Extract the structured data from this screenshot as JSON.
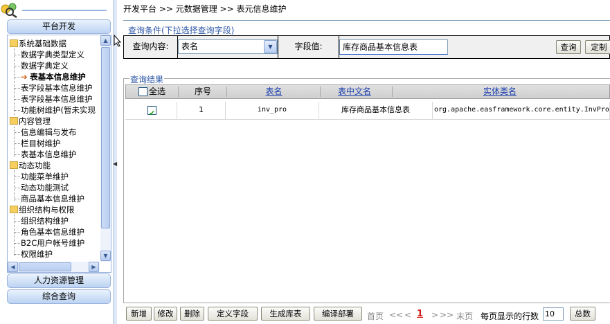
{
  "nav": {
    "headers": {
      "platform_dev": "平台开发",
      "hr_management": "人力资源管理",
      "combined_query": "综合查询"
    },
    "tree": [
      {
        "label": "系统基础数据",
        "type": "folder"
      },
      {
        "label": "数据字典类型定义",
        "type": "leaf"
      },
      {
        "label": "数据字典定义",
        "type": "leaf"
      },
      {
        "label": "表基本信息维护",
        "type": "leaf",
        "selected": true
      },
      {
        "label": "表字段基本信息维护",
        "type": "leaf"
      },
      {
        "label": "表字段基本信息维护",
        "type": "leaf"
      },
      {
        "label": "功能树维护(暂未实现",
        "type": "leaf"
      },
      {
        "label": "内容管理",
        "type": "folder"
      },
      {
        "label": "信息编辑与发布",
        "type": "leaf"
      },
      {
        "label": "栏目树维护",
        "type": "leaf"
      },
      {
        "label": "表基本信息维护",
        "type": "leaf"
      },
      {
        "label": "动态功能",
        "type": "folder"
      },
      {
        "label": "功能菜单维护",
        "type": "leaf"
      },
      {
        "label": "动态功能测试",
        "type": "leaf"
      },
      {
        "label": "商品基本信息维护",
        "type": "leaf"
      },
      {
        "label": "组织结构与权限",
        "type": "folder"
      },
      {
        "label": "组织结构维护",
        "type": "leaf"
      },
      {
        "label": "角色基本信息维护",
        "type": "leaf"
      },
      {
        "label": "B2C用户帐号维护",
        "type": "leaf"
      },
      {
        "label": "权限维护",
        "type": "leaf"
      }
    ]
  },
  "breadcrumb": "开发平台 >> 元数据管理 >> 表元信息维护",
  "query": {
    "section_title": "查询条件(下拉选择查询字段)",
    "content_label": "查询内容:",
    "content_value": "表名",
    "field_label": "字段值:",
    "field_value": "库存商品基本信息表",
    "query_button": "查询",
    "custom_button": "定制"
  },
  "results": {
    "section_title": "查询结果",
    "headers": {
      "select_all": "全选",
      "index": "序号",
      "table_name": "表名",
      "cn_name": "表中文名",
      "entity_class": "实体类名"
    },
    "rows": [
      {
        "checked": true,
        "index": "1",
        "table_name": "inv_pro",
        "cn_name": "库存商品基本信息表",
        "entity_class": "org.apache.easframework.core.entity.InvPro"
      }
    ]
  },
  "toolbar": {
    "add": "新增",
    "edit": "修改",
    "delete": "删除",
    "define_fields": "定义字段",
    "generate_table": "生成库表",
    "compile_deploy": "编译部署",
    "first_page": "首页",
    "prev_block": "<<",
    "prev_page": "<",
    "current_page": "1",
    "next_page": ">",
    "next_block": ">>",
    "last_page": "末页",
    "per_page_label": "每页显示的行数",
    "per_page_value": "10",
    "total_label": "总数"
  }
}
